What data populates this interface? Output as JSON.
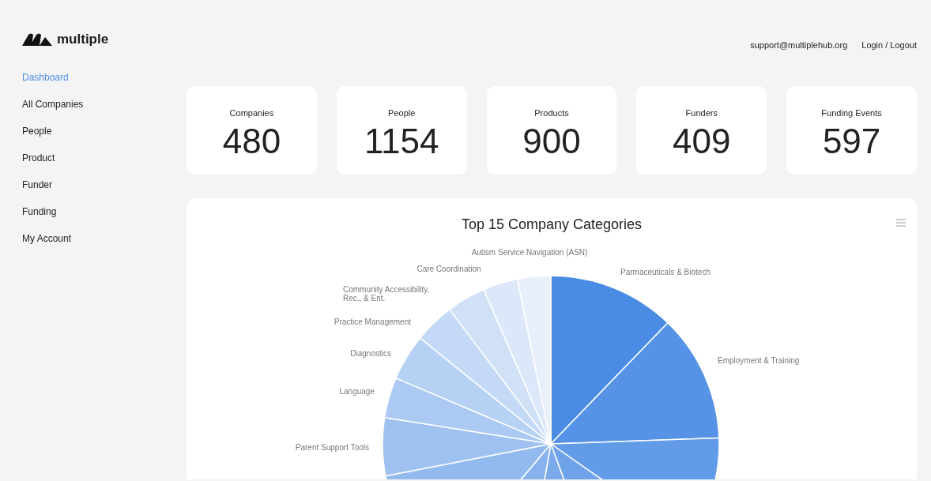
{
  "brand": {
    "name": "multiple"
  },
  "header": {
    "email": "support@multiplehub.org",
    "auth_link": "Login / Logout"
  },
  "sidebar": {
    "items": [
      {
        "label": "Dashboard",
        "selected": true
      },
      {
        "label": "All Companies",
        "selected": false
      },
      {
        "label": "People",
        "selected": false
      },
      {
        "label": "Product",
        "selected": false
      },
      {
        "label": "Funder",
        "selected": false
      },
      {
        "label": "Funding",
        "selected": false
      },
      {
        "label": "My Account",
        "selected": false
      }
    ]
  },
  "stats": [
    {
      "label": "Companies",
      "value": "480"
    },
    {
      "label": "People",
      "value": "1154"
    },
    {
      "label": "Products",
      "value": "900"
    },
    {
      "label": "Funders",
      "value": "409"
    },
    {
      "label": "Funding Events",
      "value": "597"
    }
  ],
  "chart": {
    "title": "Top 15 Company Categories",
    "slice_labels": [
      "Autism Service Navigation (ASN)",
      "Parmaceuticals & Biotech",
      "Care Coordination",
      "Community Accessibility, Rec., & Ent.",
      "Practice Management",
      "Employment & Training",
      "Diagnostics",
      "Language",
      "Parent Support Tools"
    ]
  }
}
